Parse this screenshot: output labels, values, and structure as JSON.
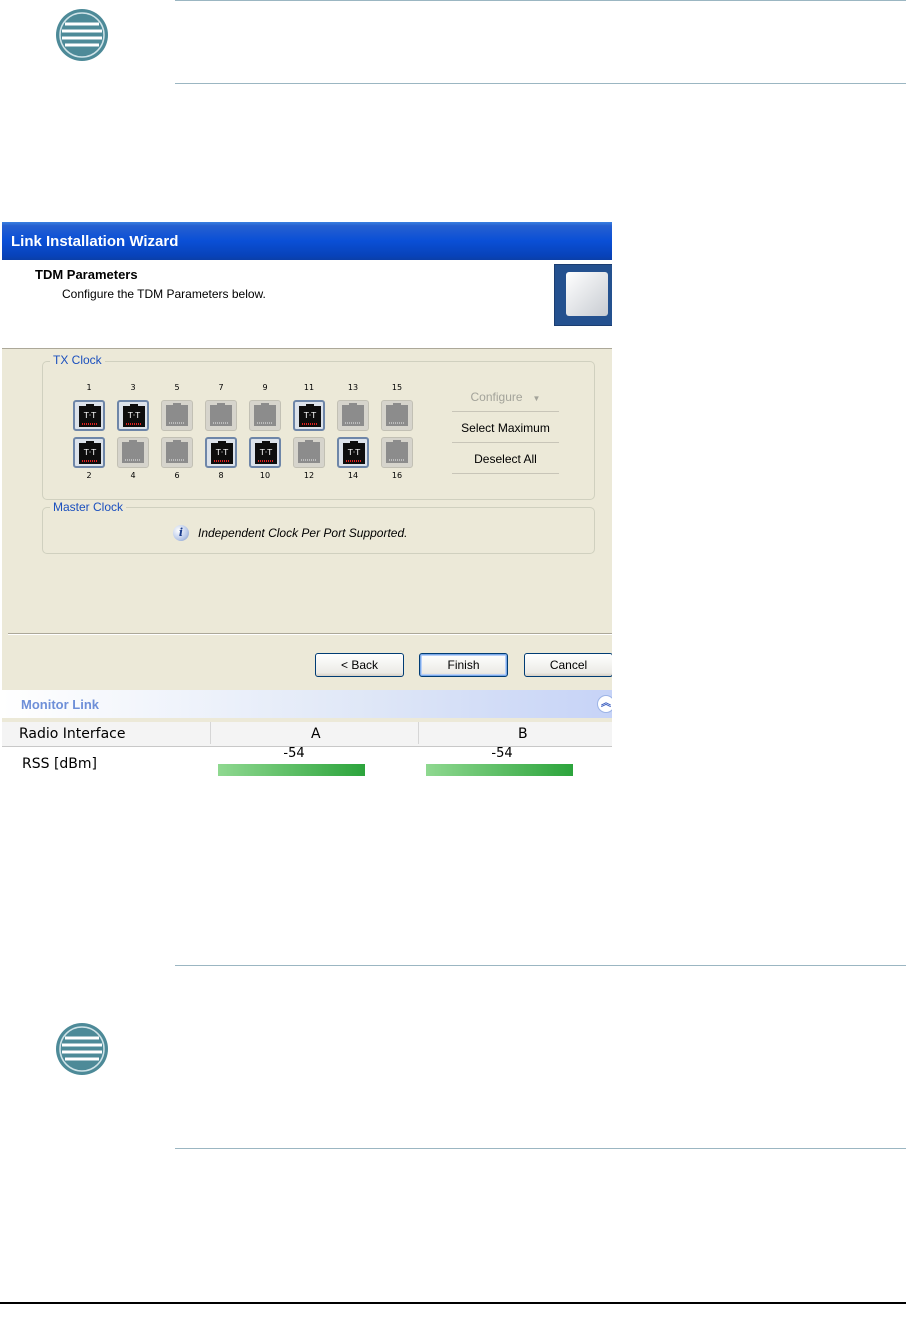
{
  "window": {
    "title": "Link Installation Wizard",
    "header_title": "TDM Parameters",
    "header_subtitle": "Configure the TDM Parameters below."
  },
  "tx_clock": {
    "legend": "TX Clock",
    "ports": [
      {
        "number": "1",
        "label": "T·T",
        "active": true
      },
      {
        "number": "2",
        "label": "T·T",
        "active": true
      },
      {
        "number": "3",
        "label": "T·T",
        "active": true
      },
      {
        "number": "4",
        "label": "",
        "active": false
      },
      {
        "number": "5",
        "label": "",
        "active": false
      },
      {
        "number": "6",
        "label": "",
        "active": false
      },
      {
        "number": "7",
        "label": "",
        "active": false
      },
      {
        "number": "8",
        "label": "T·T",
        "active": true
      },
      {
        "number": "9",
        "label": "",
        "active": false
      },
      {
        "number": "10",
        "label": "T·T",
        "active": true
      },
      {
        "number": "11",
        "label": "T·T",
        "active": true
      },
      {
        "number": "12",
        "label": "",
        "active": false
      },
      {
        "number": "13",
        "label": "",
        "active": false
      },
      {
        "number": "14",
        "label": "T·T",
        "active": true
      },
      {
        "number": "15",
        "label": "",
        "active": false
      },
      {
        "number": "16",
        "label": "",
        "active": false
      }
    ],
    "configure_label": "Configure",
    "select_max_label": "Select Maximum",
    "deselect_all_label": "Deselect All"
  },
  "master_clock": {
    "legend": "Master Clock",
    "info_text": "Independent Clock Per Port Supported."
  },
  "buttons": {
    "back": "< Back",
    "finish": "Finish",
    "cancel": "Cancel"
  },
  "monitor": {
    "title": "Monitor Link",
    "header_label": "Radio Interface",
    "col_a": "A",
    "col_b": "B",
    "row_label": "RSS [dBm]",
    "rss_a": "-54",
    "rss_b": "-54",
    "rss_a_level": 0.98,
    "rss_b_level": 0.98
  },
  "icons": {
    "note": "note-icon",
    "info": "info-icon",
    "collapse": "chevron-double-up-icon",
    "dropdown": "chevron-down-icon"
  },
  "colors": {
    "titlebar": "#0a4fd6",
    "legend": "#1a4fbe",
    "monitor_title": "#6e8fd8",
    "rss_bar": "#2ca43c",
    "note_icon": "#4d8a98"
  }
}
